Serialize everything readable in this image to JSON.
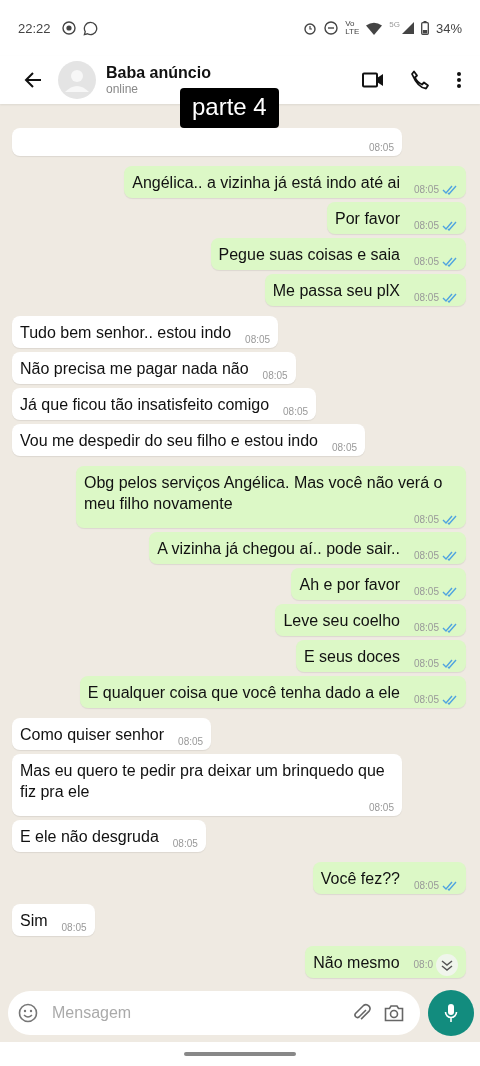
{
  "status_bar": {
    "time": "22:22",
    "volte": [
      "Vo",
      "LTE"
    ],
    "network": "5G",
    "battery": "34%"
  },
  "header": {
    "name": "Baba anúncio",
    "status": "online"
  },
  "overlay_caption": "parte 4",
  "messages": [
    {
      "outgoing": false,
      "time": "08:05"
    },
    {
      "outgoing": true,
      "text": "Angélica.. a vizinha já está indo até ai",
      "time": "08:05",
      "read": true
    },
    {
      "outgoing": true,
      "text": "Por favor",
      "time": "08:05",
      "read": true
    },
    {
      "outgoing": true,
      "text": "Pegue suas coisas e saia",
      "time": "08:05",
      "read": true
    },
    {
      "outgoing": true,
      "text": "Me passa seu plX",
      "time": "08:05",
      "read": true
    },
    {
      "outgoing": false,
      "text": "Tudo bem senhor.. estou indo",
      "time": "08:05"
    },
    {
      "outgoing": false,
      "text": "Não precisa me pagar nada não",
      "time": "08:05"
    },
    {
      "outgoing": false,
      "text": "Já que ficou tão insatisfeito comigo",
      "time": "08:05"
    },
    {
      "outgoing": false,
      "text": "Vou me despedir do seu filho e estou indo",
      "time": "08:05"
    },
    {
      "outgoing": true,
      "text": "Obg pelos serviços Angélica. Mas você não verá o meu filho novamente",
      "time": "08:05",
      "read": true
    },
    {
      "outgoing": true,
      "text": "A vizinha já chegou aí.. pode sair..",
      "time": "08:05",
      "read": true
    },
    {
      "outgoing": true,
      "text": "Ah e por favor",
      "time": "08:05",
      "read": true
    },
    {
      "outgoing": true,
      "text": "Leve seu coelho",
      "time": "08:05",
      "read": true
    },
    {
      "outgoing": true,
      "text": "E seus doces",
      "time": "08:05",
      "read": true
    },
    {
      "outgoing": true,
      "text": "E qualquer coisa que você tenha dado a ele",
      "time": "08:05",
      "read": true
    },
    {
      "outgoing": false,
      "text": "Como quiser senhor",
      "time": "08:05"
    },
    {
      "outgoing": false,
      "text": "Mas eu quero te pedir pra deixar um brinquedo que fiz pra ele",
      "time": "08:05"
    },
    {
      "outgoing": false,
      "text": "E ele não desgruda",
      "time": "08:05"
    },
    {
      "outgoing": true,
      "text": "Você fez??",
      "time": "08:05",
      "read": true
    },
    {
      "outgoing": false,
      "text": "Sim",
      "time": "08:05"
    },
    {
      "outgoing": true,
      "text": "Não mesmo",
      "time": "08:0"
    }
  ],
  "composer": {
    "placeholder": "Mensagem"
  }
}
